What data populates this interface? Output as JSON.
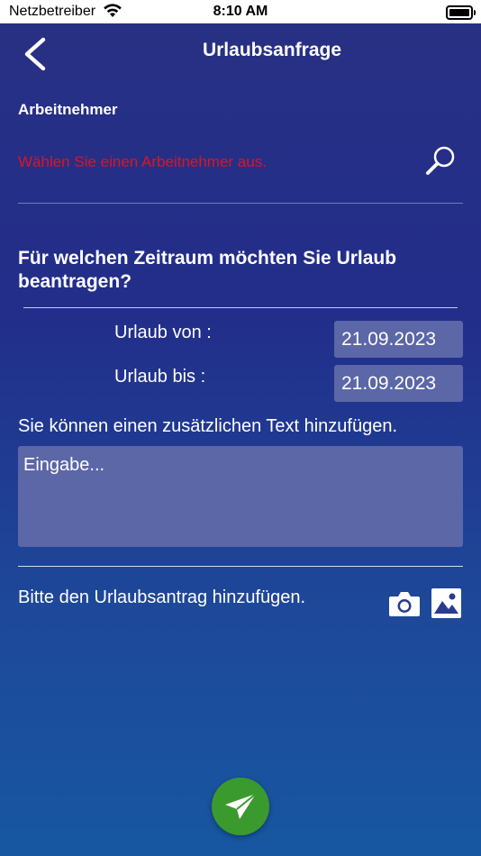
{
  "statusbar": {
    "carrier": "Netzbetreiber",
    "time": "8:10 AM"
  },
  "header": {
    "title": "Urlaubsanfrage",
    "back_icon": "chevron-left-icon"
  },
  "employee": {
    "label": "Arbeitnehmer",
    "placeholder": "Wählen Sie einen Arbeitnehmer aus.",
    "placeholder_color": "#e0141e",
    "search_icon": "search-icon"
  },
  "period": {
    "question": "Für welchen Zeitraum möchten Sie Urlaub beantragen?",
    "from_label": "Urlaub von :",
    "from_value": "21.09.2023",
    "to_label": "Urlaub bis :",
    "to_value": "21.09.2023"
  },
  "note": {
    "hint": "Sie können einen zusätzlichen Text hinzufügen.",
    "placeholder": "Eingabe..."
  },
  "attachment": {
    "label": "Bitte den Urlaubsantrag hinzufügen.",
    "camera_icon": "camera-icon",
    "gallery_icon": "image-icon"
  },
  "send": {
    "icon": "paper-plane-icon",
    "color": "#3a9a2e"
  },
  "theme": {
    "background_top": "#283084",
    "background_bottom": "#1757a1",
    "field": "#5b67a7"
  }
}
